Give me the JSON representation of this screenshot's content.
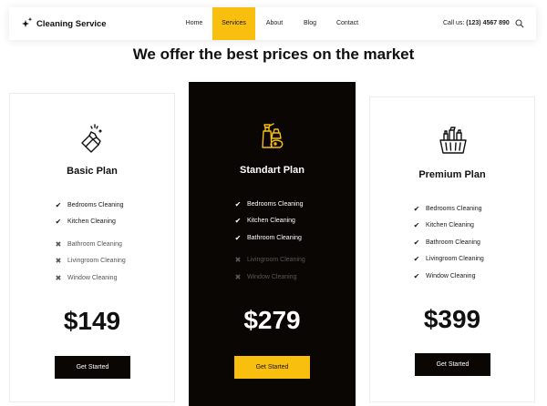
{
  "brand": {
    "name": "Cleaning Service"
  },
  "nav": {
    "items": [
      {
        "label": "Home"
      },
      {
        "label": "Services"
      },
      {
        "label": "About"
      },
      {
        "label": "Blog"
      },
      {
        "label": "Contact"
      }
    ],
    "active": "Services",
    "call_label": "Call us:",
    "phone": "(123) 4567 890",
    "search_icon": "search-icon"
  },
  "headline": "We offer the best prices on the market",
  "colors": {
    "accent": "#f9bf0f",
    "dark": "#0a0604"
  },
  "plans": [
    {
      "name": "Basic Plan",
      "icon": "cleaning-gloves-icon",
      "features": [
        {
          "label": "Bedrooms Cleaning",
          "included": true
        },
        {
          "label": "Kitchen Cleaning",
          "included": true
        },
        {
          "label": "Bathroom Cleaning",
          "included": false
        },
        {
          "label": "Livingroom Cleaning",
          "included": false
        },
        {
          "label": "Window Cleaning",
          "included": false
        }
      ],
      "price": "$149",
      "button": "Get Started"
    },
    {
      "name": "Standart Plan",
      "icon": "cleaning-supplies-icon",
      "features": [
        {
          "label": "Bedrooms Cleaning",
          "included": true
        },
        {
          "label": "Kitchen Cleaning",
          "included": true
        },
        {
          "label": "Bathroom Cleaning",
          "included": true
        },
        {
          "label": "Livingroom Cleaning",
          "included": false
        },
        {
          "label": "Window Cleaning",
          "included": false
        }
      ],
      "price": "$279",
      "button": "Get Started"
    },
    {
      "name": "Premium Plan",
      "icon": "cleaning-basket-icon",
      "features": [
        {
          "label": "Bedrooms Cleaning",
          "included": true
        },
        {
          "label": "Kitchen Cleaning",
          "included": true
        },
        {
          "label": "Bathroom Cleaning",
          "included": true
        },
        {
          "label": "Livingroom Cleaning",
          "included": true
        },
        {
          "label": "Window Cleaning",
          "included": true
        }
      ],
      "price": "$399",
      "button": "Get Started"
    }
  ]
}
